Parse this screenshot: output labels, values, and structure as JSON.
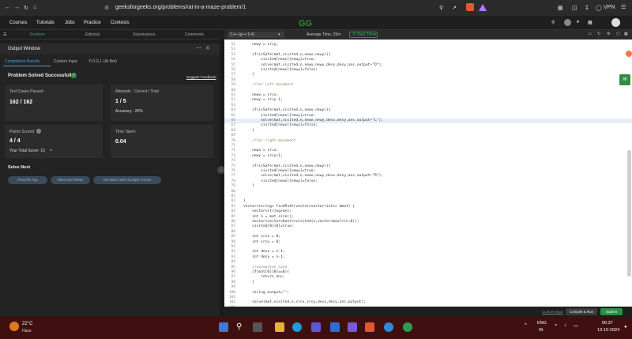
{
  "browser": {
    "url": "geeksforgeeks.org/problems/rat-in-a-maze-problem/1",
    "vpn": "VPN"
  },
  "nav": {
    "items": [
      "Courses",
      "Tutorials",
      "Jobs",
      "Practice",
      "Contests"
    ]
  },
  "problem_tabs": [
    "Problem",
    "Editorial",
    "Submissions",
    "Comments"
  ],
  "editor": {
    "language": "C++ (g++ 5.4)",
    "avg_time": "Average Time: 25m",
    "start_timer": "Start Timer"
  },
  "output": {
    "title": "Output Window",
    "tabs": [
      "Compilation Results",
      "Custom Input",
      "Y.O.G.I. (AI Bot)"
    ],
    "status": "Problem Solved Successfully",
    "suggest": "Suggest Feedback",
    "tests_label": "Test Cases Passed",
    "tests_value": "162 / 162",
    "attempts_label": "Attempts : Correct / Total",
    "attempts_value": "1 / 5",
    "accuracy": "Accuracy : 20%",
    "points_label": "Points Scored",
    "points_value": "4 / 4",
    "total_score": "Your Total Score: 10",
    "time_label": "Time Taken",
    "time_value": "0.04",
    "solve_next": "Solve Next",
    "next": [
      "Flood fill Algo",
      "Black and White",
      "Rat Maze With Multiple Jumps"
    ]
  },
  "bottom": {
    "custom_input": "Custom Input",
    "compile": "Compile & Run",
    "submit": "Submit"
  },
  "taskbar": {
    "temp": "22°C",
    "weather": "Haze",
    "lang1": "ENG",
    "lang2": "IN",
    "time": "00:37",
    "date": "13-10-2024"
  },
  "code": [
    {
      "n": "51",
      "t": "    newy = srcy;"
    },
    {
      "n": "52",
      "t": ""
    },
    {
      "n": "53",
      "t": "    if(isSafe(mat,visited,n,newx,newy)){"
    },
    {
      "n": "54",
      "t": "        visited[newx][newy]=true;"
    },
    {
      "n": "55",
      "t": "        solve(mat,visited,n,newx,newy,desx,desy,ans,output+\"D\");"
    },
    {
      "n": "56",
      "t": "        visited[newx][newy]=false;"
    },
    {
      "n": "57",
      "t": "    }"
    },
    {
      "n": "58",
      "t": ""
    },
    {
      "n": "59",
      "t": "    //for left movement"
    },
    {
      "n": "60",
      "t": ""
    },
    {
      "n": "61",
      "t": "    newx = srcx;"
    },
    {
      "n": "62",
      "t": "    newy = srcy-1;"
    },
    {
      "n": "63",
      "t": ""
    },
    {
      "n": "64",
      "t": "    if(isSafe(mat,visited,n,newx,newy)){"
    },
    {
      "n": "65",
      "t": "        visited[newx][newy]=true;"
    },
    {
      "n": "66",
      "t": "        solve(mat,visited,n,newx,newy,desx,desy,ans,output+\"L\");"
    },
    {
      "n": "67",
      "t": "        visited[newx][newy]=false;"
    },
    {
      "n": "68",
      "t": "    }"
    },
    {
      "n": "69",
      "t": ""
    },
    {
      "n": "70",
      "t": "    //for right movement"
    },
    {
      "n": "71",
      "t": ""
    },
    {
      "n": "72",
      "t": "    newx = srcx;"
    },
    {
      "n": "73",
      "t": "    newy = srcy+1;"
    },
    {
      "n": "74",
      "t": ""
    },
    {
      "n": "75",
      "t": "    if(isSafe(mat,visited,n,newx,newy)){"
    },
    {
      "n": "76",
      "t": "        visited[newx][newy]=true;"
    },
    {
      "n": "77",
      "t": "        solve(mat,visited,n,newx,newy,desx,desy,ans,output+\"R\");"
    },
    {
      "n": "78",
      "t": "        visited[newx][newy]=false;"
    },
    {
      "n": "79",
      "t": "    }"
    },
    {
      "n": "80",
      "t": ""
    },
    {
      "n": "81",
      "t": ""
    },
    {
      "n": "82",
      "t": "}"
    },
    {
      "n": "83",
      "t": "vector<string> findPath(vector<vector<int>> &mat) {"
    },
    {
      "n": "84",
      "t": "    vector<string>ans;"
    },
    {
      "n": "85",
      "t": "    int n = mat.size();"
    },
    {
      "n": "86",
      "t": "    vector<vector<bool>>visited(n,vector<bool>(n,0));"
    },
    {
      "n": "87",
      "t": "    visited[0][0]=true;"
    },
    {
      "n": "88",
      "t": ""
    },
    {
      "n": "89",
      "t": "    int srcx = 0;"
    },
    {
      "n": "90",
      "t": "    int srcy = 0;"
    },
    {
      "n": "91",
      "t": ""
    },
    {
      "n": "92",
      "t": "    int desx = n-1;"
    },
    {
      "n": "93",
      "t": "    int desy = n-1;"
    },
    {
      "n": "94",
      "t": ""
    },
    {
      "n": "95",
      "t": "    //exception case"
    },
    {
      "n": "96",
      "t": "    if(mat[0][0]==0){"
    },
    {
      "n": "97",
      "t": "        return ans;"
    },
    {
      "n": "98",
      "t": "    }"
    },
    {
      "n": "99",
      "t": ""
    },
    {
      "n": "100",
      "t": "    string output=\"\";"
    },
    {
      "n": "101",
      "t": ""
    },
    {
      "n": "102",
      "t": "    solve(mat,visited,n,srcx,srcy,desx,desy,ans,output);"
    },
    {
      "n": "103",
      "t": ""
    }
  ]
}
